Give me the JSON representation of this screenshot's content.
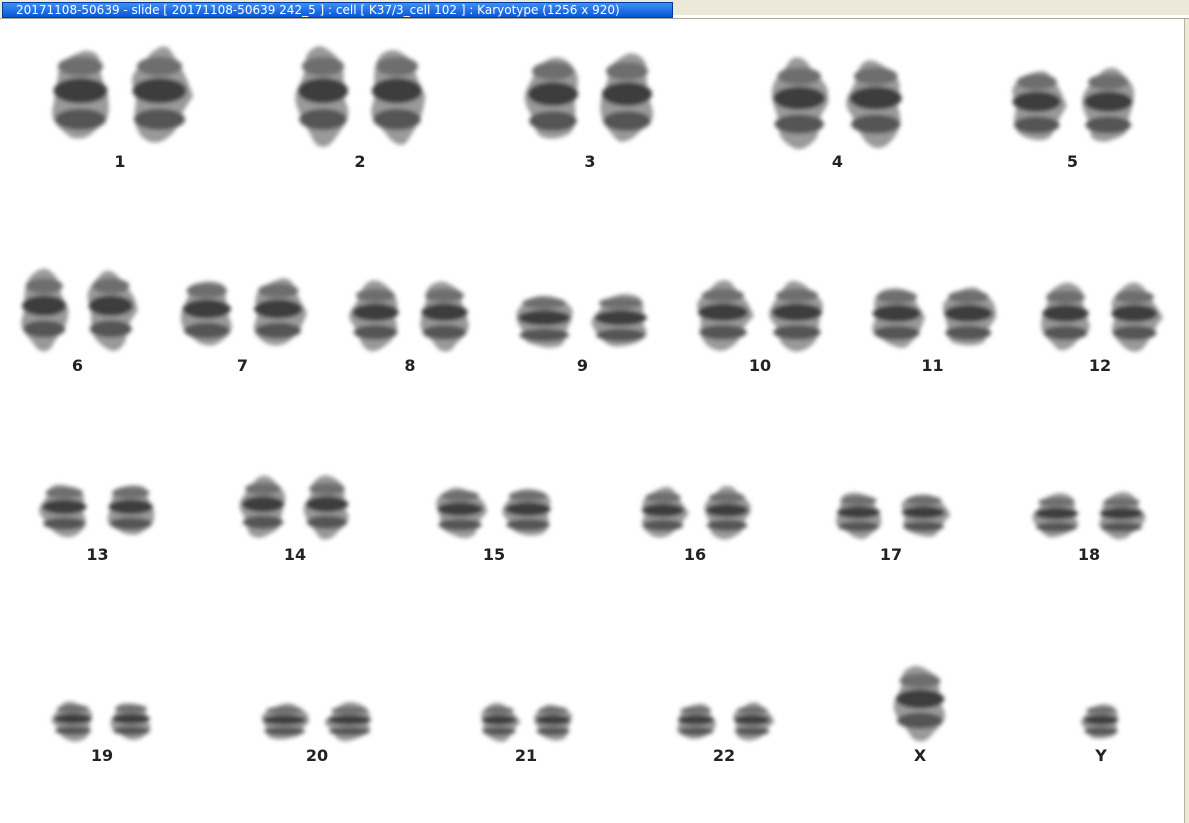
{
  "window": {
    "title": "20171108-50639 - slide [ 20171108-50639 242_5 ] : cell [ K37/3_cell 102 ] : Karyotype  (1256 x 920)"
  },
  "karyotype": {
    "chromosomes": [
      {
        "label": "1"
      },
      {
        "label": "2"
      },
      {
        "label": "3"
      },
      {
        "label": "4"
      },
      {
        "label": "5"
      },
      {
        "label": "6"
      },
      {
        "label": "7"
      },
      {
        "label": "8"
      },
      {
        "label": "9"
      },
      {
        "label": "10"
      },
      {
        "label": "11"
      },
      {
        "label": "12"
      },
      {
        "label": "13"
      },
      {
        "label": "14"
      },
      {
        "label": "15"
      },
      {
        "label": "16"
      },
      {
        "label": "17"
      },
      {
        "label": "18"
      },
      {
        "label": "19"
      },
      {
        "label": "20"
      },
      {
        "label": "21"
      },
      {
        "label": "22"
      },
      {
        "label": "X"
      },
      {
        "label": "Y"
      }
    ]
  }
}
